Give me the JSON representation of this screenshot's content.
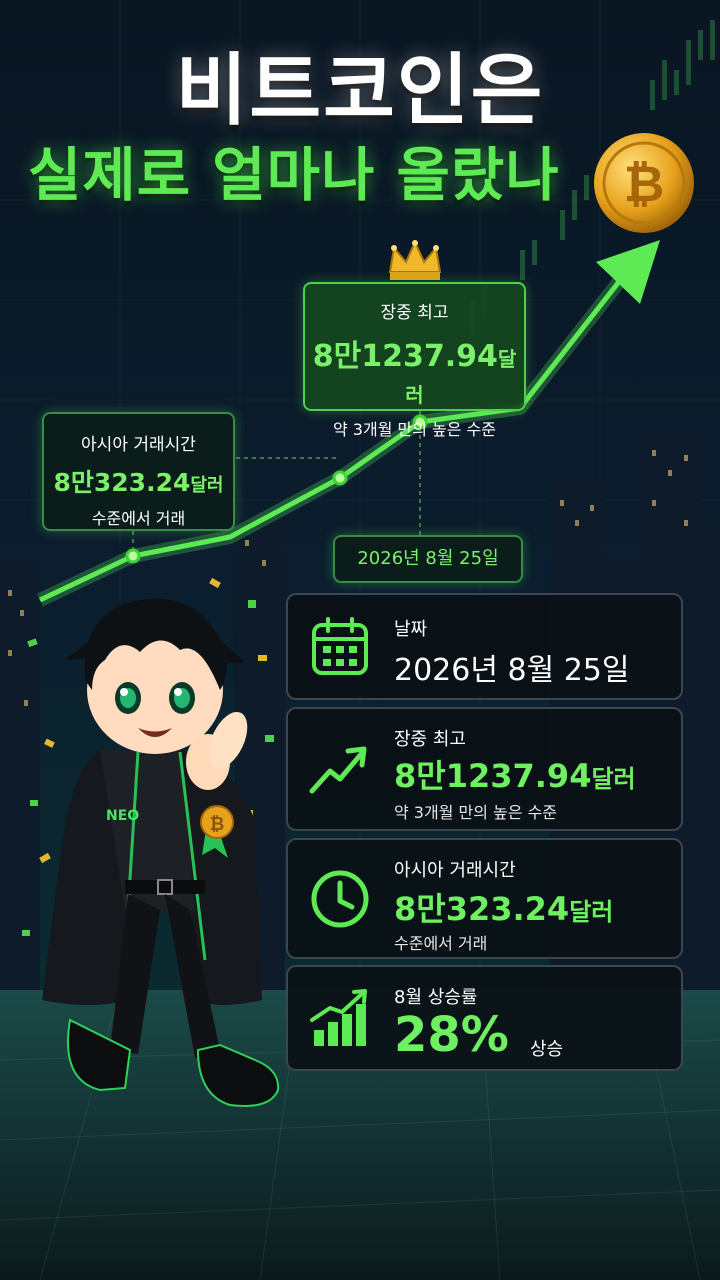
{
  "title": {
    "line1": "비트코인은",
    "line2": "실제로 얼마나 올랐나"
  },
  "colors": {
    "accent": "#6ef060",
    "background": "#061018",
    "card_border": "#3c4650"
  },
  "callouts": {
    "peak": {
      "label": "장중 최고",
      "value": "8만1237.94",
      "unit": "달러",
      "sub": "약 3개월 만의 높은 수준"
    },
    "asia": {
      "label": "아시아 거래시간",
      "value": "8만323.24",
      "unit": "달러",
      "sub": "수준에서 거래"
    },
    "date": {
      "text": "2026년 8월 25일"
    }
  },
  "cards": [
    {
      "icon": "calendar-icon",
      "title": "날짜",
      "value": "2026년 8월 25일"
    },
    {
      "icon": "trend-up-icon",
      "title": "장중 최고",
      "value": "8만1237.94",
      "unit": "달러",
      "sub": "약 3개월 만의 높은 수준"
    },
    {
      "icon": "clock-icon",
      "title": "아시아 거래시간",
      "value": "8만323.24",
      "unit": "달러",
      "sub": "수준에서 거래"
    },
    {
      "icon": "bar-chart-icon",
      "title": "8월 상승률",
      "value": "28%",
      "sub": "상승"
    }
  ],
  "badge": {
    "jacket_text": "NEO"
  }
}
